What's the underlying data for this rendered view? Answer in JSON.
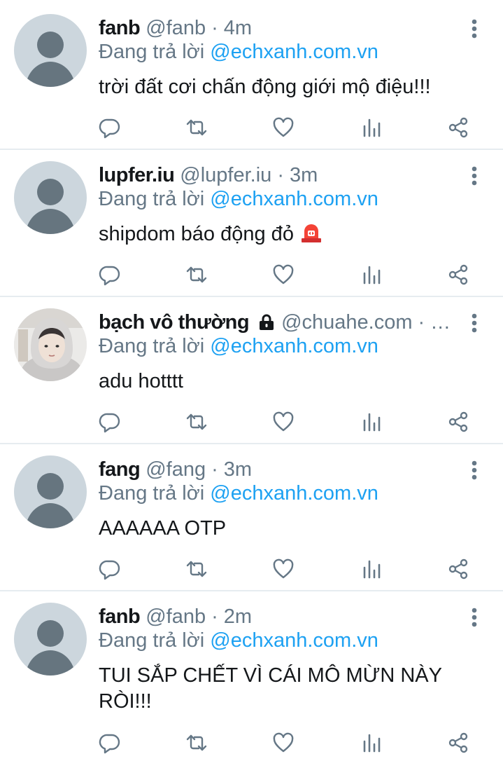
{
  "colors": {
    "link": "#1da1f2",
    "muted": "#657786",
    "divider": "#e6ecf0",
    "avatar_bg": "#ccd6dd"
  },
  "reply_prefix": "Đang trả lời",
  "tweets": [
    {
      "name": "fanb",
      "handle": "@fanb",
      "dot": "·",
      "time": "4m",
      "reply_to": "@echxanh.com.vn",
      "text": "trời đất cơi chấn động giới mộ điệu!!!"
    },
    {
      "name": "lupfer.iu",
      "handle": "@lupfer.iu",
      "dot": "·",
      "time": "3m",
      "reply_to": "@echxanh.com.vn",
      "text": "shipdom báo động đỏ",
      "emoji": "rotating-light-icon"
    },
    {
      "name": "bạch vô thường",
      "handle": "@chuahe.com",
      "dot": "·",
      "time": "…",
      "reply_to": "@echxanh.com.vn",
      "text": "adu hotttt",
      "protected": true
    },
    {
      "name": "fang",
      "handle": "@fang",
      "dot": "·",
      "time": "3m",
      "reply_to": "@echxanh.com.vn",
      "text": "AAAAAA OTP"
    },
    {
      "name": "fanb",
      "handle": "@fanb",
      "dot": "·",
      "time": "2m",
      "reply_to": "@echxanh.com.vn",
      "text": "TUI SẮP CHẾT VÌ CÁI MÔ MỪN NÀY RÒI!!!"
    }
  ],
  "actions": [
    "reply-icon",
    "retweet-icon",
    "like-icon",
    "analytics-icon",
    "share-icon"
  ]
}
